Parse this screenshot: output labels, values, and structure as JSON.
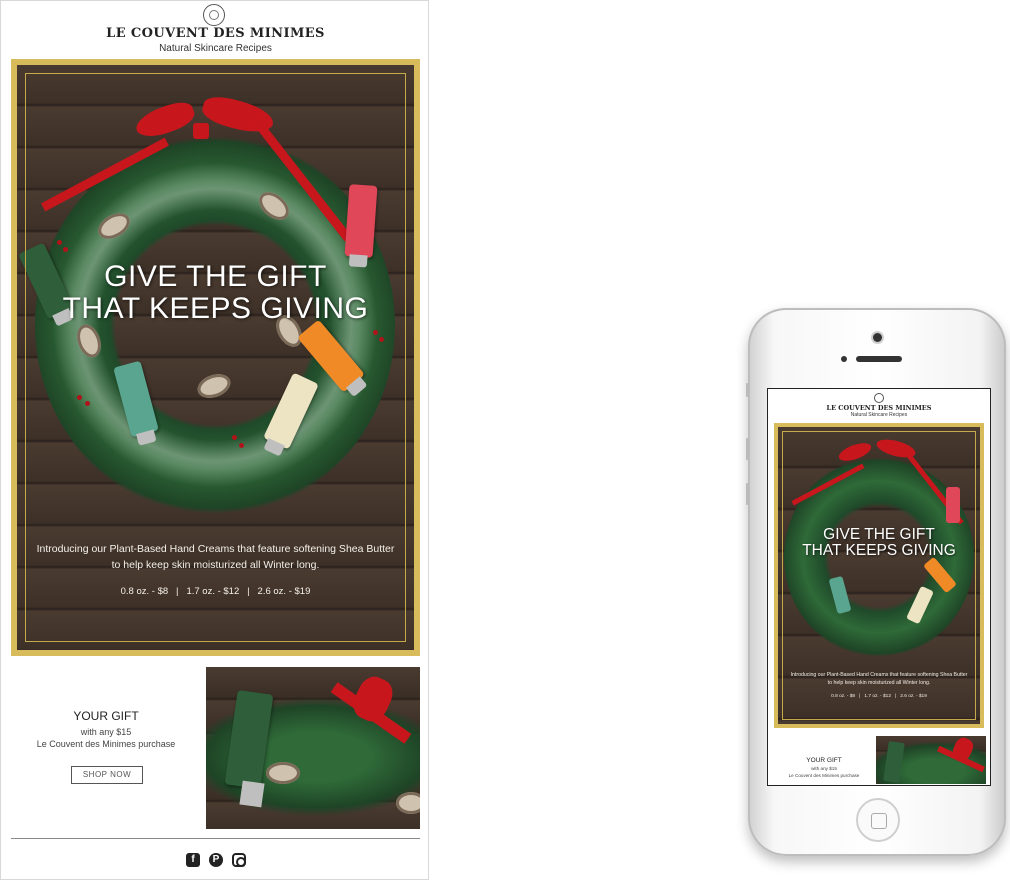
{
  "brand": {
    "name": "Le Couvent des Minimes",
    "tagline": "Natural Skincare Recipes",
    "logo_text": "LE COUVENT DES MINIMES"
  },
  "hero": {
    "title_line1": "GIVE THE GIFT",
    "title_line2": "THAT KEEPS GIVING",
    "description_line1": "Introducing our Plant-Based Hand Creams that feature softening Shea Butter",
    "description_line2": "to help keep skin moisturized all Winter long.",
    "prices": "0.8 oz. - $8   |   1.7 oz. - $12   |   2.6 oz. - $19",
    "border_color": "#d8bb5a",
    "ribbon_color": "#c8161d"
  },
  "gift": {
    "title": "YOUR GIFT",
    "line1": "with any $15",
    "line2": "Le Couvent des Minimes purchase",
    "button_label": "SHOP NOW"
  },
  "social": {
    "facebook": "f",
    "pinterest": "P"
  },
  "icons": [
    "logo-seal-icon",
    "facebook-icon",
    "pinterest-icon",
    "instagram-icon"
  ]
}
